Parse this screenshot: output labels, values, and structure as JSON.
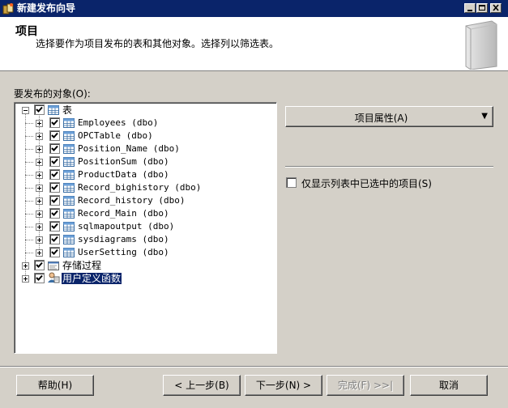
{
  "window": {
    "title": "新建发布向导",
    "title_bg": "#0a246a"
  },
  "header": {
    "title": "项目",
    "description": "选择要作为项目发布的表和其他对象。选择列以筛选表。"
  },
  "objects_label": "要发布的对象(O):",
  "tree": {
    "root": {
      "label": "表",
      "checked": true,
      "expanded": true,
      "icon": "table-icon"
    },
    "tables": [
      {
        "label": "Employees (dbo)",
        "checked": true
      },
      {
        "label": "OPCTable (dbo)",
        "checked": true
      },
      {
        "label": "Position_Name (dbo)",
        "checked": true
      },
      {
        "label": "PositionSum (dbo)",
        "checked": true
      },
      {
        "label": "ProductData (dbo)",
        "checked": true
      },
      {
        "label": "Record_bighistory (dbo)",
        "checked": true
      },
      {
        "label": "Record_history (dbo)",
        "checked": true
      },
      {
        "label": "Record_Main (dbo)",
        "checked": true
      },
      {
        "label": "sqlmapoutput (dbo)",
        "checked": true
      },
      {
        "label": "sysdiagrams (dbo)",
        "checked": true
      },
      {
        "label": "UserSetting (dbo)",
        "checked": true
      }
    ],
    "stored_procedures": {
      "label": "存储过程",
      "checked": true,
      "icon": "stored-procedure-icon"
    },
    "user_functions": {
      "label": "用户定义函数",
      "checked": true,
      "selected": true,
      "icon": "user-function-icon"
    }
  },
  "item_properties_button": "项目属性(A)",
  "filter_checkbox": {
    "label": "仅显示列表中已选中的项目(S)",
    "checked": false
  },
  "buttons": {
    "help": "帮助(H)",
    "back": "< 上一步(B)",
    "next": "下一步(N) >",
    "finish": "完成(F) >>|",
    "cancel": "取消"
  }
}
